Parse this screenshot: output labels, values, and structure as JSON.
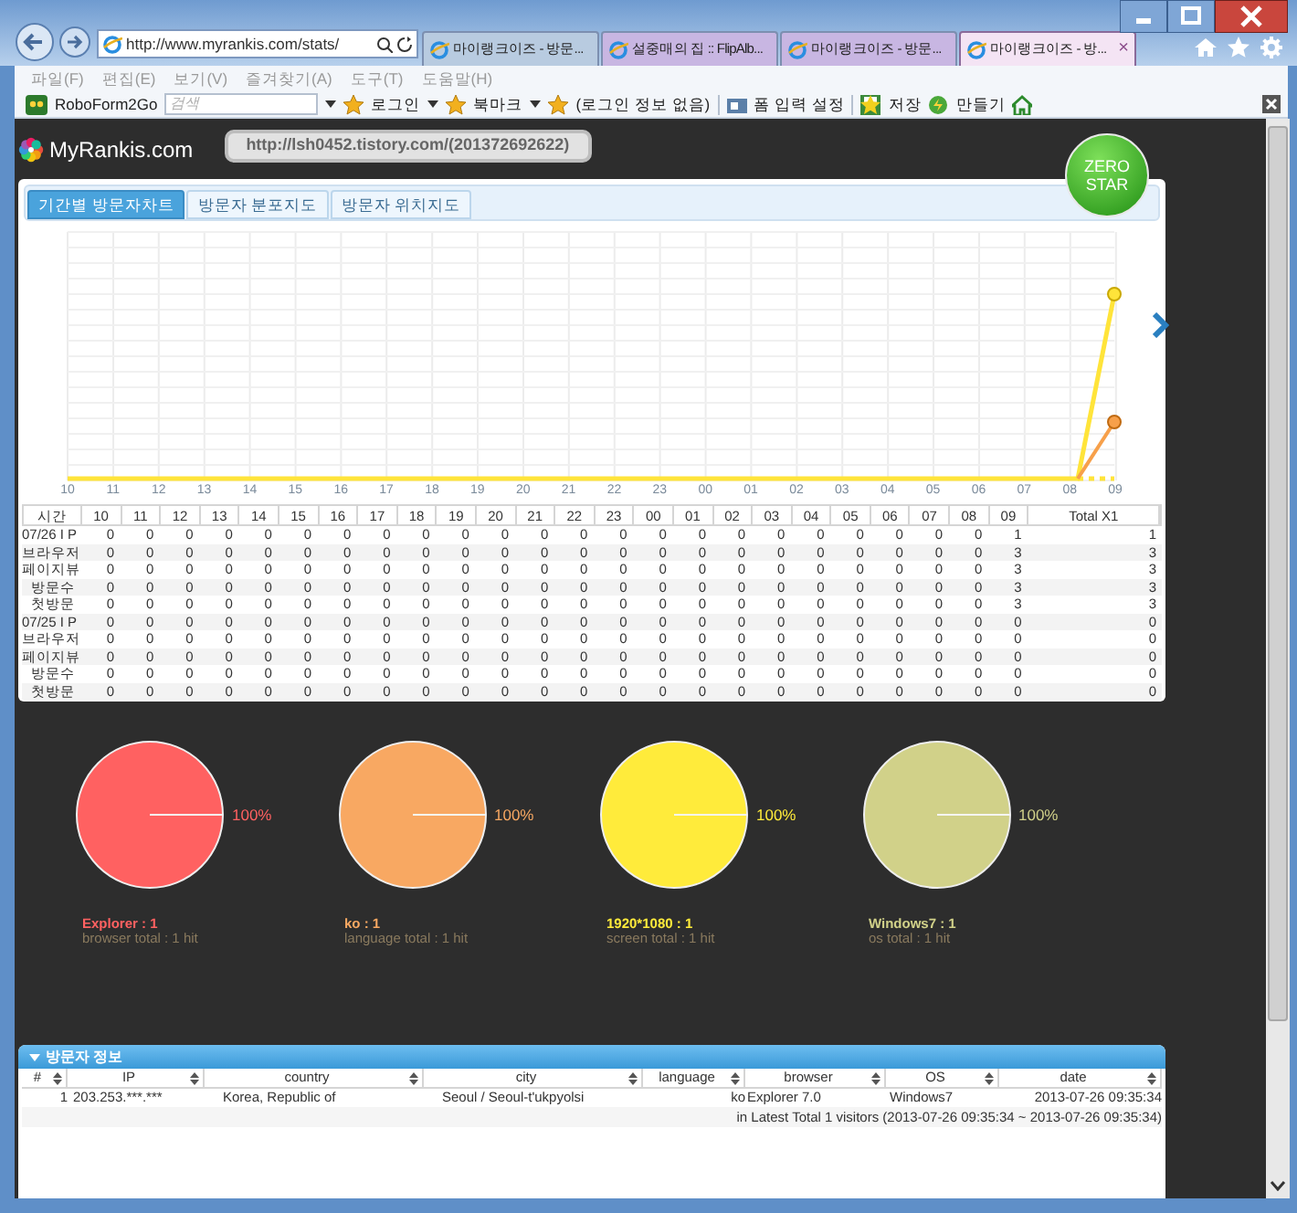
{
  "browser": {
    "address": "http://www.myrankis.com/stats/",
    "tabs": [
      {
        "label": "마이랭크이즈 - 방문...",
        "selected": false,
        "color": "#b8cbe0"
      },
      {
        "label": "설중매의 집 :: FlipAlb...",
        "selected": false,
        "color": "#c8b6e2"
      },
      {
        "label": "마이랭크이즈 - 방문...",
        "selected": false,
        "color": "#c8b6e2"
      },
      {
        "label": "마이랭크이즈 - 방...",
        "selected": true,
        "color": "#f4e4f4"
      }
    ],
    "tab_close": "×",
    "menu": [
      "파일(F)",
      "편집(E)",
      "보기(V)",
      "즐겨찾기(A)",
      "도구(T)",
      "도움말(H)"
    ],
    "toolbar": {
      "roboform": "RoboForm2Go",
      "search_placeholder": "검색",
      "login": "로그인",
      "bookmark": "북마크",
      "login_info": "(로그인 정보 없음)",
      "form_settings": "폼 입력 설정",
      "save": "저장",
      "create": "만들기"
    }
  },
  "site": {
    "logo": "MyRankis.com",
    "url_bubble": "http://lsh0452.tistory.com/(201372692622)",
    "badge": "ZERO STAR"
  },
  "tabs": [
    {
      "label": "기간별 방문자차트",
      "selected": true
    },
    {
      "label": "방문자 분포지도",
      "selected": false
    },
    {
      "label": "방문자 위치지도",
      "selected": false
    }
  ],
  "chart_x_labels": [
    "10",
    "11",
    "12",
    "13",
    "14",
    "15",
    "16",
    "17",
    "18",
    "19",
    "20",
    "21",
    "22",
    "23",
    "00",
    "01",
    "02",
    "03",
    "04",
    "05",
    "06",
    "07",
    "08",
    "09"
  ],
  "table": {
    "columns": [
      "시간",
      "10",
      "11",
      "12",
      "13",
      "14",
      "15",
      "16",
      "17",
      "18",
      "19",
      "20",
      "21",
      "22",
      "23",
      "00",
      "01",
      "02",
      "03",
      "04",
      "05",
      "06",
      "07",
      "08",
      "09",
      "Total X1"
    ],
    "rows": [
      [
        "07/26 I P",
        "0",
        "0",
        "0",
        "0",
        "0",
        "0",
        "0",
        "0",
        "0",
        "0",
        "0",
        "0",
        "0",
        "0",
        "0",
        "0",
        "0",
        "0",
        "0",
        "0",
        "0",
        "0",
        "0",
        "1",
        "1"
      ],
      [
        "브라우저",
        "0",
        "0",
        "0",
        "0",
        "0",
        "0",
        "0",
        "0",
        "0",
        "0",
        "0",
        "0",
        "0",
        "0",
        "0",
        "0",
        "0",
        "0",
        "0",
        "0",
        "0",
        "0",
        "0",
        "3",
        "3"
      ],
      [
        "페이지뷰",
        "0",
        "0",
        "0",
        "0",
        "0",
        "0",
        "0",
        "0",
        "0",
        "0",
        "0",
        "0",
        "0",
        "0",
        "0",
        "0",
        "0",
        "0",
        "0",
        "0",
        "0",
        "0",
        "0",
        "3",
        "3"
      ],
      [
        "방문수",
        "0",
        "0",
        "0",
        "0",
        "0",
        "0",
        "0",
        "0",
        "0",
        "0",
        "0",
        "0",
        "0",
        "0",
        "0",
        "0",
        "0",
        "0",
        "0",
        "0",
        "0",
        "0",
        "0",
        "3",
        "3"
      ],
      [
        "첫방문",
        "0",
        "0",
        "0",
        "0",
        "0",
        "0",
        "0",
        "0",
        "0",
        "0",
        "0",
        "0",
        "0",
        "0",
        "0",
        "0",
        "0",
        "0",
        "0",
        "0",
        "0",
        "0",
        "0",
        "3",
        "3"
      ],
      [
        "07/25 I P",
        "0",
        "0",
        "0",
        "0",
        "0",
        "0",
        "0",
        "0",
        "0",
        "0",
        "0",
        "0",
        "0",
        "0",
        "0",
        "0",
        "0",
        "0",
        "0",
        "0",
        "0",
        "0",
        "0",
        "0",
        "0"
      ],
      [
        "브라우저",
        "0",
        "0",
        "0",
        "0",
        "0",
        "0",
        "0",
        "0",
        "0",
        "0",
        "0",
        "0",
        "0",
        "0",
        "0",
        "0",
        "0",
        "0",
        "0",
        "0",
        "0",
        "0",
        "0",
        "0",
        "0"
      ],
      [
        "페이지뷰",
        "0",
        "0",
        "0",
        "0",
        "0",
        "0",
        "0",
        "0",
        "0",
        "0",
        "0",
        "0",
        "0",
        "0",
        "0",
        "0",
        "0",
        "0",
        "0",
        "0",
        "0",
        "0",
        "0",
        "0",
        "0"
      ],
      [
        "방문수",
        "0",
        "0",
        "0",
        "0",
        "0",
        "0",
        "0",
        "0",
        "0",
        "0",
        "0",
        "0",
        "0",
        "0",
        "0",
        "0",
        "0",
        "0",
        "0",
        "0",
        "0",
        "0",
        "0",
        "0",
        "0"
      ],
      [
        "첫방문",
        "0",
        "0",
        "0",
        "0",
        "0",
        "0",
        "0",
        "0",
        "0",
        "0",
        "0",
        "0",
        "0",
        "0",
        "0",
        "0",
        "0",
        "0",
        "0",
        "0",
        "0",
        "0",
        "0",
        "0",
        "0"
      ]
    ]
  },
  "pies": [
    {
      "percent": "100%",
      "label": "Explorer : 1",
      "total": "browser total : 1 hit",
      "color": "#ff6161"
    },
    {
      "percent": "100%",
      "label": "ko : 1",
      "total": "language total : 1 hit",
      "color": "#f8a862"
    },
    {
      "percent": "100%",
      "label": "1920*1080 : 1",
      "total": "screen total : 1 hit",
      "color": "#ffeb3b"
    },
    {
      "percent": "100%",
      "label": "Windows7 : 1",
      "total": "os total : 1 hit",
      "color": "#d1d189"
    }
  ],
  "visitors": {
    "title": "방문자 정보",
    "columns": [
      "#",
      "IP",
      "country",
      "city",
      "language",
      "browser",
      "OS",
      "date"
    ],
    "rows": [
      [
        "1",
        "203.253.***.***",
        "Korea, Republic of",
        "Seoul / Seoul-t'ukpyolsi",
        "ko",
        "Explorer 7.0",
        "Windows7",
        "2013-07-26 09:35:34"
      ]
    ],
    "footer": "in Latest Total 1 visitors (2013-07-26 09:35:34 ~ 2013-07-26 09:35:34)"
  }
}
